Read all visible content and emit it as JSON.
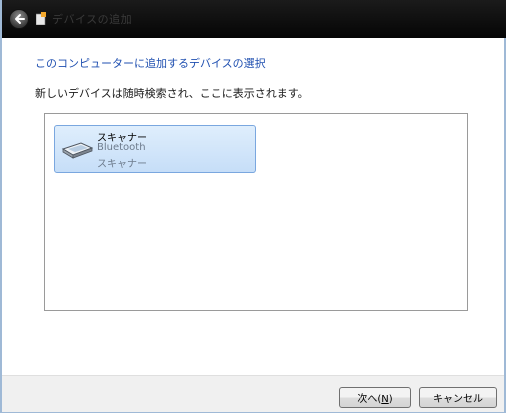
{
  "window": {
    "title": "デバイスの追加",
    "icons": {
      "back": "back-arrow-icon",
      "title": "device-add-icon"
    }
  },
  "main": {
    "heading": "このコンピューターに追加するデバイスの選択",
    "description": "新しいデバイスは随時検索され、ここに表示されます。"
  },
  "devices": [
    {
      "name": "スキャナー",
      "connection": "Bluetooth",
      "category": "スキャナー",
      "icon": "scanner-icon",
      "selected": true
    }
  ],
  "footer": {
    "next_prefix": "次へ(",
    "next_mnemonic": "N",
    "next_suffix": ")",
    "cancel_label": "キャンセル"
  },
  "colors": {
    "heading": "#1f4fb0",
    "titlebar": "#0a0a0a",
    "selection": "#c6def8",
    "selection_border": "#7aa7df"
  }
}
